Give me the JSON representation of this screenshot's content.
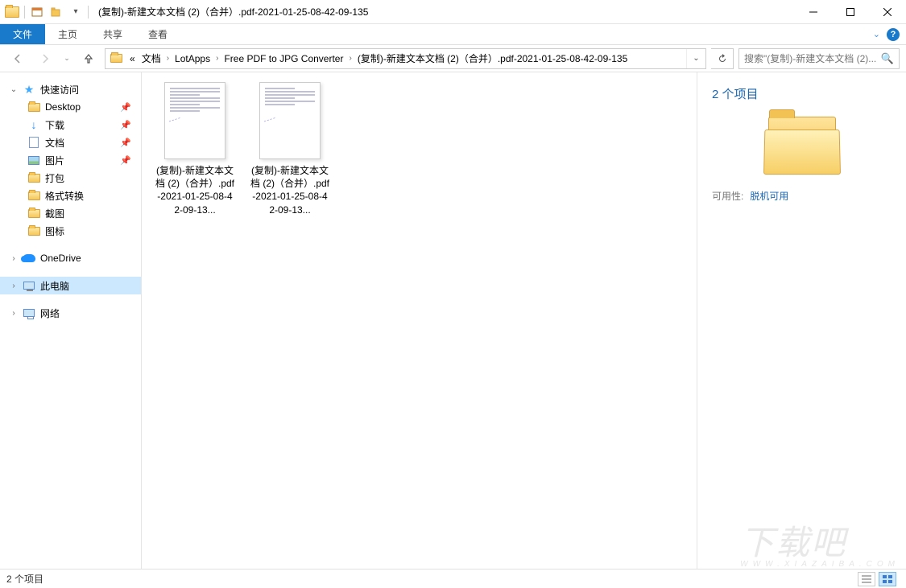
{
  "qat": {
    "dropdown_hint": "▾"
  },
  "window": {
    "title": "(复制)-新建文本文档 (2)（合并）.pdf-2021-01-25-08-42-09-135"
  },
  "ribbon": {
    "file": "文件",
    "home": "主页",
    "share": "共享",
    "view": "查看"
  },
  "breadcrumb": {
    "prefix": "«",
    "items": [
      "文档",
      "LotApps",
      "Free PDF to JPG Converter",
      "(复制)-新建文本文档 (2)（合并）.pdf-2021-01-25-08-42-09-135"
    ]
  },
  "search": {
    "placeholder": "搜索\"(复制)-新建文本文档 (2)..."
  },
  "sidebar": {
    "quick_access": "快速访问",
    "items": [
      {
        "label": "Desktop",
        "pinned": true,
        "icon": "folder"
      },
      {
        "label": "下载",
        "pinned": true,
        "icon": "download"
      },
      {
        "label": "文档",
        "pinned": true,
        "icon": "doc"
      },
      {
        "label": "图片",
        "pinned": true,
        "icon": "img"
      },
      {
        "label": "打包",
        "pinned": false,
        "icon": "folder"
      },
      {
        "label": "格式转换",
        "pinned": false,
        "icon": "folder"
      },
      {
        "label": "截图",
        "pinned": false,
        "icon": "folder"
      },
      {
        "label": "图标",
        "pinned": false,
        "icon": "folder"
      }
    ],
    "onedrive": "OneDrive",
    "thispc": "此电脑",
    "network": "网络"
  },
  "files": [
    {
      "name": "(复制)-新建文本文档 (2)（合并）.pdf-2021-01-25-08-42-09-13..."
    },
    {
      "name": "(复制)-新建文本文档 (2)（合并）.pdf-2021-01-25-08-42-09-13..."
    }
  ],
  "details": {
    "title": "2 个项目",
    "availability_label": "可用性:",
    "availability_value": "脱机可用"
  },
  "statusbar": {
    "count": "2 个项目"
  },
  "watermark": {
    "main": "下载吧",
    "sub": "WWW.XIAZAIBA.COM"
  }
}
